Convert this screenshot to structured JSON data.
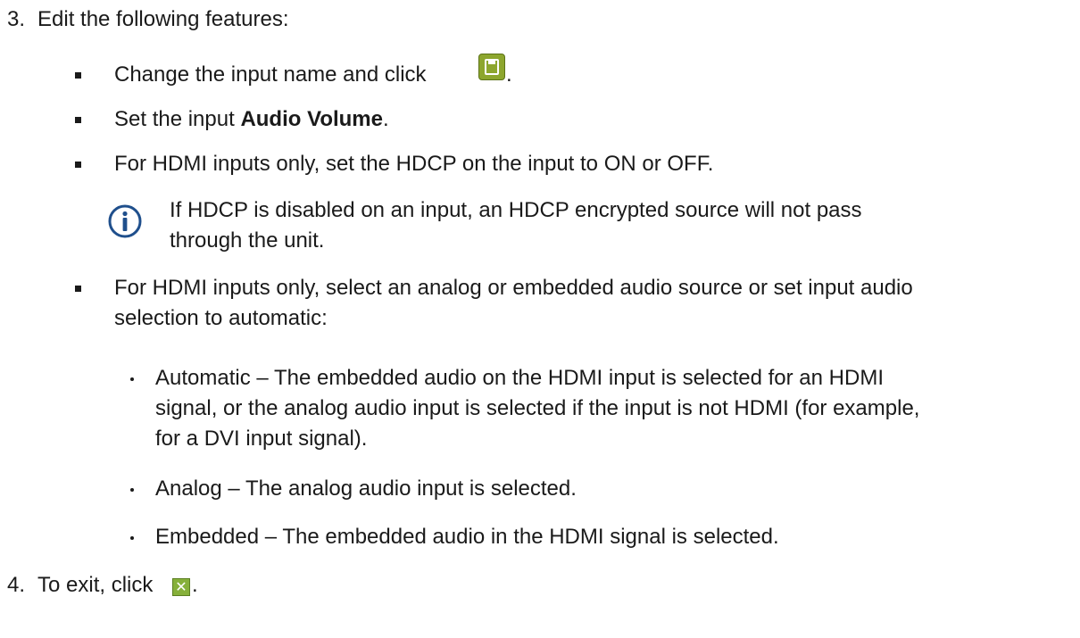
{
  "steps": [
    {
      "number": "3.",
      "text": "Edit the following features:",
      "bullets": [
        {
          "before": "Change the input name and click ",
          "after": "."
        },
        {
          "before": "Set the input ",
          "bold": "Audio Volume",
          "after": "."
        },
        {
          "text": "For HDMI inputs only, set the HDCP on the input to ON or OFF."
        },
        {
          "lines": [
            "For HDMI inputs only, select an analog or embedded audio source or set input audio",
            "selection to automatic:"
          ]
        }
      ],
      "note": {
        "lines": [
          "If HDCP is disabled on an input, an HDCP encrypted source will not pass",
          "through the unit."
        ]
      },
      "subitems": [
        {
          "lines": [
            "Automatic – The embedded audio on the HDMI input is selected for an HDMI",
            "signal, or the analog audio input is selected if the input is not HDMI (for example,",
            "for a DVI input signal)."
          ]
        },
        {
          "lines": [
            "Analog – The analog audio input is selected."
          ]
        },
        {
          "lines": [
            "Embedded – The embedded audio in the HDMI signal is selected."
          ]
        }
      ]
    },
    {
      "number": "4.",
      "before": "To exit, click ",
      "after": "."
    }
  ],
  "icons": {
    "save": "save-icon",
    "close": "close-icon",
    "info": "info-icon"
  },
  "colors": {
    "save_icon": "#8da62e",
    "close_icon": "#86b03a",
    "info_icon": "#1f4f8c"
  }
}
